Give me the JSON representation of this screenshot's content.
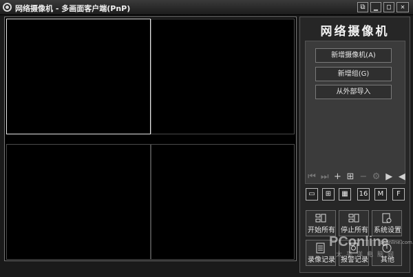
{
  "window": {
    "title": "网络摄像机 - 多画面客户端(PnP)",
    "buttons": {
      "extra": "⧉",
      "minimize": "▁",
      "maximize": "□",
      "close": "✕"
    }
  },
  "panel": {
    "brand": "网络摄像机",
    "commands": [
      "新增摄像机(A)",
      "新增组(G)",
      "从外部导入"
    ],
    "layouts": [
      "1",
      "4",
      "9",
      "16",
      "M",
      "F"
    ],
    "actions": [
      "开始所有",
      "停止所有",
      "系统设置",
      "录像记录",
      "报警记录",
      "其他"
    ]
  },
  "watermark": {
    "main": "PConline",
    "sub": "太平洋电脑网",
    "url": "pconline.com.cn"
  },
  "icons": {
    "tools": [
      "skip-back-icon",
      "skip-forward-icon",
      "plus-icon",
      "add-group-icon",
      "minus-icon",
      "gear-icon",
      "export-icon",
      "import-icon"
    ]
  }
}
